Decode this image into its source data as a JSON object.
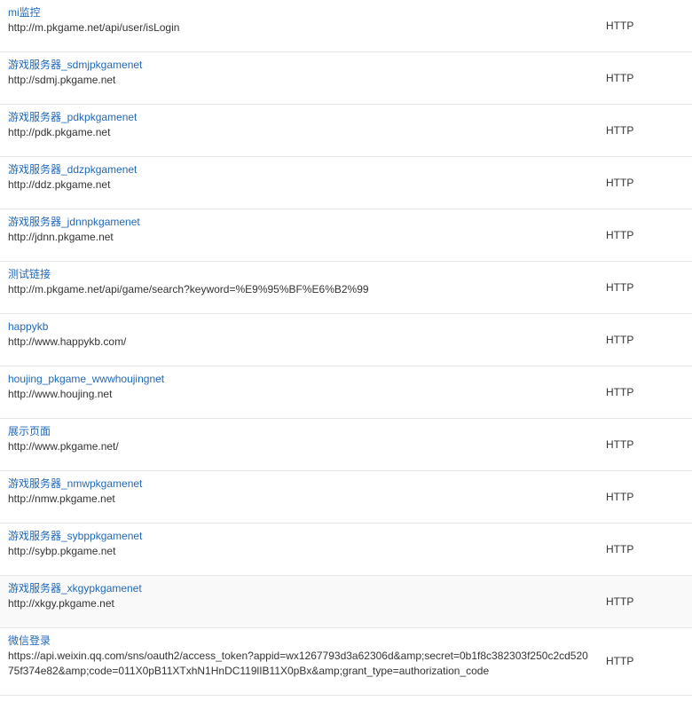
{
  "monitors": [
    {
      "name": "mi监控",
      "url": "http://m.pkgame.net/api/user/isLogin",
      "type": "HTTP"
    },
    {
      "name": "游戏服务器_sdmjpkgamenet",
      "url": "http://sdmj.pkgame.net",
      "type": "HTTP"
    },
    {
      "name": "游戏服务器_pdkpkgamenet",
      "url": "http://pdk.pkgame.net",
      "type": "HTTP"
    },
    {
      "name": "游戏服务器_ddzpkgamenet",
      "url": "http://ddz.pkgame.net",
      "type": "HTTP"
    },
    {
      "name": "游戏服务器_jdnnpkgamenet",
      "url": "http://jdnn.pkgame.net",
      "type": "HTTP"
    },
    {
      "name": "测试链接",
      "url": "http://m.pkgame.net/api/game/search?keyword=%E9%95%BF%E6%B2%99",
      "type": "HTTP"
    },
    {
      "name": "happykb",
      "url": "http://www.happykb.com/",
      "type": "HTTP"
    },
    {
      "name": "houjing_pkgame_wwwhoujingnet",
      "url": "http://www.houjing.net",
      "type": "HTTP"
    },
    {
      "name": "展示页面",
      "url": "http://www.pkgame.net/",
      "type": "HTTP"
    },
    {
      "name": "游戏服务器_nmwpkgamenet",
      "url": "http://nmw.pkgame.net",
      "type": "HTTP"
    },
    {
      "name": "游戏服务器_sybppkgamenet",
      "url": "http://sybp.pkgame.net",
      "type": "HTTP"
    },
    {
      "name": "游戏服务器_xkgypkgamenet",
      "url": "http://xkgy.pkgame.net",
      "type": "HTTP"
    },
    {
      "name": "微信登录",
      "url": "https://api.weixin.qq.com/sns/oauth2/access_token?appid=wx1267793d3a62306d&amp;secret=0b1f8c382303f250c2cd52075f374e82&amp;code=011X0pB11XTxhN1HnDC119lIB11X0pBx&amp;grant_type=authorization_code",
      "type": "HTTP"
    }
  ]
}
